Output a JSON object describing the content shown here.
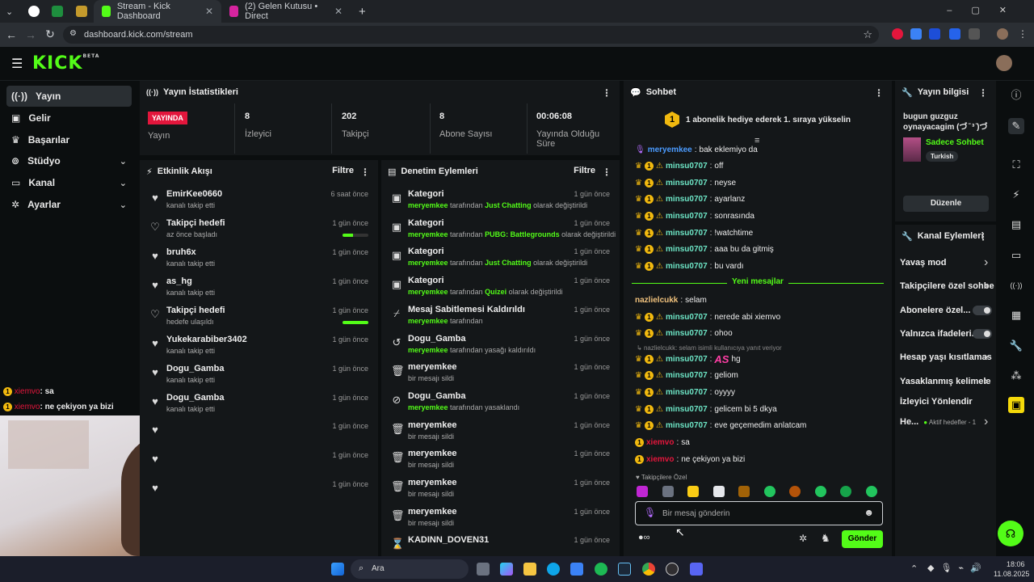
{
  "browser": {
    "tabs": [
      {
        "label": ""
      },
      {
        "label": ""
      },
      {
        "label": ""
      },
      {
        "label": "Stream - Kick Dashboard"
      },
      {
        "label": "(2) Gelen Kutusu • Direct"
      }
    ],
    "url": "dashboard.kick.com/stream",
    "colors": {
      "accent": "#53fc18",
      "live": "#e3163c",
      "gold": "#f1b90f"
    }
  },
  "header": {
    "logo": "KICK",
    "beta": "BETA"
  },
  "sidebar": {
    "items": [
      {
        "label": "Yayın",
        "icon": "broadcast-icon"
      },
      {
        "label": "Gelir",
        "icon": "wallet-icon"
      },
      {
        "label": "Başarılar",
        "icon": "trophy-icon"
      },
      {
        "label": "Stüdyo",
        "icon": "studio-icon"
      },
      {
        "label": "Kanal",
        "icon": "channel-icon"
      },
      {
        "label": "Ayarlar",
        "icon": "gear-icon"
      }
    ]
  },
  "stats": {
    "title": "Yayın İstatistikleri",
    "live_badge": "YAYINDA",
    "cells": [
      {
        "value": "",
        "label": "Yayın"
      },
      {
        "value": "8",
        "label": "İzleyici"
      },
      {
        "value": "202",
        "label": "Takipçi"
      },
      {
        "value": "8",
        "label": "Abone Sayısı"
      },
      {
        "value": "00:06:08",
        "label": "Yayında Olduğu Süre"
      }
    ]
  },
  "activity": {
    "title": "Etkinlik Akışı",
    "filter": "Filtre",
    "rows": [
      {
        "name": "EmirKee0660",
        "sub": "kanalı takip etti",
        "time": "6 saat önce",
        "icon": "heart",
        "progress": null
      },
      {
        "name": "Takipçi hedefi",
        "sub": "az önce başladı",
        "time": "1 gün önce",
        "icon": "heart-outline",
        "progress": 0.4
      },
      {
        "name": "bruh6x",
        "sub": "kanalı takip etti",
        "time": "1 gün önce",
        "icon": "heart",
        "progress": null
      },
      {
        "name": "as_hg",
        "sub": "kanalı takip etti",
        "time": "1 gün önce",
        "icon": "heart",
        "progress": null
      },
      {
        "name": "Takipçi hedefi",
        "sub": "hedefe ulaşıldı",
        "time": "1 gün önce",
        "icon": "heart-outline",
        "progress": 1.0
      },
      {
        "name": "Yukekarabiber3402",
        "sub": "kanalı takip etti",
        "time": "1 gün önce",
        "icon": "heart",
        "progress": null
      },
      {
        "name": "Dogu_Gamba",
        "sub": "kanalı takip etti",
        "time": "1 gün önce",
        "icon": "heart",
        "progress": null
      },
      {
        "name": "Dogu_Gamba",
        "sub": "kanalı takip etti",
        "time": "1 gün önce",
        "icon": "heart",
        "progress": null
      },
      {
        "name": "",
        "sub": "",
        "time": "1 gün önce",
        "icon": "heart",
        "progress": null
      },
      {
        "name": "",
        "sub": "",
        "time": "1 gün önce",
        "icon": "heart",
        "progress": null
      },
      {
        "name": "",
        "sub": "",
        "time": "1 gün önce",
        "icon": "heart",
        "progress": null
      }
    ]
  },
  "moderation": {
    "title": "Denetim Eylemleri",
    "filter": "Filtre",
    "rows": [
      {
        "title": "Kategori",
        "user": "meryemkee",
        "mid": " tarafından ",
        "target": "Just Chatting",
        "end": " olarak değiştirildi",
        "time": "1 gün önce",
        "icon": "category"
      },
      {
        "title": "Kategori",
        "user": "meryemkee",
        "mid": " tarafından ",
        "target": "PUBG: Battlegrounds",
        "end": " olarak değiştirildi",
        "time": "1 gün önce",
        "icon": "category"
      },
      {
        "title": "Kategori",
        "user": "meryemkee",
        "mid": " tarafından ",
        "target": "Just Chatting",
        "end": " olarak değiştirildi",
        "time": "1 gün önce",
        "icon": "category"
      },
      {
        "title": "Kategori",
        "user": "meryemkee",
        "mid": " tarafından ",
        "target": "Quizei",
        "end": " olarak değiştirildi",
        "time": "1 gün önce",
        "icon": "category"
      },
      {
        "title": "Mesaj Sabitlemesi Kaldırıldı",
        "user": "meryemkee",
        "mid": " tarafından",
        "target": "",
        "end": "",
        "time": "1 gün önce",
        "icon": "unpin"
      },
      {
        "title": "Dogu_Gamba",
        "user": "meryemkee",
        "mid": " tarafından yasağı kaldırıldı",
        "target": "",
        "end": "",
        "time": "1 gün önce",
        "icon": "undo"
      },
      {
        "title": "meryemkee",
        "user": "",
        "mid": "bir mesajı sildi",
        "target": "",
        "end": "",
        "time": "1 gün önce",
        "icon": "trash"
      },
      {
        "title": "Dogu_Gamba",
        "user": "meryemkee",
        "mid": " tarafından yasaklandı",
        "target": "",
        "end": "",
        "time": "1 gün önce",
        "icon": "ban"
      },
      {
        "title": "meryemkee",
        "user": "",
        "mid": "bir mesajı sildi",
        "target": "",
        "end": "",
        "time": "1 gün önce",
        "icon": "trash"
      },
      {
        "title": "meryemkee",
        "user": "",
        "mid": "bir mesajı sildi",
        "target": "",
        "end": "",
        "time": "1 gün önce",
        "icon": "trash"
      },
      {
        "title": "meryemkee",
        "user": "",
        "mid": "bir mesajı sildi",
        "target": "",
        "end": "",
        "time": "1 gün önce",
        "icon": "trash"
      },
      {
        "title": "meryemkee",
        "user": "",
        "mid": "bir mesajı sildi",
        "target": "",
        "end": "",
        "time": "1 gün önce",
        "icon": "trash"
      },
      {
        "title": "KADINN_DOVEN31",
        "user": "",
        "mid": "",
        "target": "",
        "end": "",
        "time": "1 gün önce",
        "icon": "hourglass"
      }
    ]
  },
  "chat": {
    "title": "Sohbet",
    "gift_banner": "1 abonelik hediye ederek 1. sıraya yükselin",
    "gift_rank": "1",
    "new_messages": "Yeni mesajlar",
    "reply_hint": "nazlielcukk: selam isimli kullanıcıya yanıt veriyor",
    "followers_only": "Takipçilere Özel",
    "input_placeholder": "Bir mesaj gönderin",
    "send": "Gönder",
    "messages": [
      {
        "user": "meryemkee",
        "text": "bak eklemiyo da",
        "color": "#4b9bff",
        "badges": "mod"
      },
      {
        "user": "minsu0707",
        "text": "off",
        "color": "#6ee7c7",
        "badges": "full"
      },
      {
        "user": "minsu0707",
        "text": "neyse",
        "color": "#6ee7c7",
        "badges": "full"
      },
      {
        "user": "minsu0707",
        "text": "ayarlanz",
        "color": "#6ee7c7",
        "badges": "full"
      },
      {
        "user": "minsu0707",
        "text": "sonrasında",
        "color": "#6ee7c7",
        "badges": "full"
      },
      {
        "user": "minsu0707",
        "text": "!watchtime",
        "color": "#6ee7c7",
        "badges": "full"
      },
      {
        "user": "minsu0707",
        "text": "aaa bu da gitmiş",
        "color": "#6ee7c7",
        "badges": "full"
      },
      {
        "user": "minsu0707",
        "text": "bu vardı",
        "color": "#6ee7c7",
        "badges": "full"
      },
      {
        "user": "nazlielcukk",
        "text": "selam",
        "color": "#f1c27d",
        "badges": "none"
      },
      {
        "user": "minsu0707",
        "text": "nerede abi xiemvo",
        "color": "#6ee7c7",
        "badges": "full"
      },
      {
        "user": "minsu0707",
        "text": "ohoo",
        "color": "#6ee7c7",
        "badges": "full"
      },
      {
        "user": "minsu0707",
        "text": "hg",
        "color": "#6ee7c7",
        "badges": "full",
        "emote": "AS"
      },
      {
        "user": "minsu0707",
        "text": "geliom",
        "color": "#6ee7c7",
        "badges": "full"
      },
      {
        "user": "minsu0707",
        "text": "oyyyy",
        "color": "#6ee7c7",
        "badges": "full"
      },
      {
        "user": "minsu0707",
        "text": "gelicem bi 5 dkya",
        "color": "#6ee7c7",
        "badges": "full"
      },
      {
        "user": "minsu0707",
        "text": "eve geçemedim anlatcam",
        "color": "#6ee7c7",
        "badges": "full"
      },
      {
        "user": "xiemvo",
        "text": "sa",
        "color": "#e3163c",
        "badges": "sub"
      },
      {
        "user": "xiemvo",
        "text": "ne çekiyon ya bizi",
        "color": "#e3163c",
        "badges": "sub"
      }
    ]
  },
  "stream_info": {
    "title": "Yayın bilgisi",
    "stream_title": "bugun guzguz oynayacagim (づ ̄ ³ ̄)づ",
    "category": "Sadece Sohbet",
    "language": "Turkish",
    "edit": "Düzenle"
  },
  "channel_actions": {
    "title": "Kanal Eylemleri",
    "rows": [
      {
        "label": "Yavaş mod",
        "control": "chevron"
      },
      {
        "label": "Takipçilere özel sohbe",
        "control": "chevron"
      },
      {
        "label": "Abonelere özel...",
        "control": "toggle"
      },
      {
        "label": "Yalnızca ifadeleri...",
        "control": "toggle"
      },
      {
        "label": "Hesap yaşı kısıtlamas",
        "control": "chevron"
      },
      {
        "label": "Yasaklanmış kelimele",
        "control": "chevron"
      },
      {
        "label": "İzleyici Yönlendir",
        "control": "none"
      },
      {
        "label": "He...",
        "control": "chevron",
        "extra": "Aktif hedefler - 1"
      }
    ]
  },
  "overlay_chat": [
    {
      "user": "xiemvo",
      "text": ": sa"
    },
    {
      "user": "xiemvo",
      "text": ": ne çekiyon ya bizi"
    }
  ],
  "taskbar": {
    "search": "Ara",
    "time": "18:06",
    "date": "11.08.2025"
  }
}
